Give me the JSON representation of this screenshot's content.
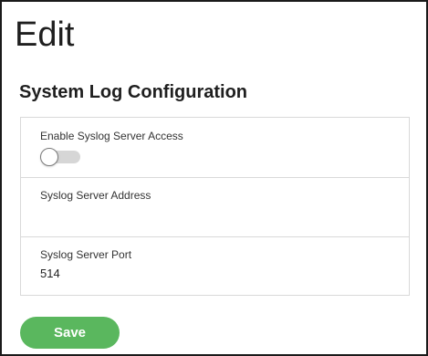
{
  "page": {
    "title": "Edit",
    "section_title": "System Log Configuration"
  },
  "form": {
    "enable_syslog": {
      "label": "Enable Syslog Server Access",
      "checked": false
    },
    "server_address": {
      "label": "Syslog Server Address",
      "value": ""
    },
    "server_port": {
      "label": "Syslog Server Port",
      "value": "514"
    }
  },
  "actions": {
    "save_label": "Save"
  },
  "colors": {
    "save_button": "#5ab75e",
    "toggle_off_track": "#d6d6d6",
    "border": "#d9d9d9"
  }
}
